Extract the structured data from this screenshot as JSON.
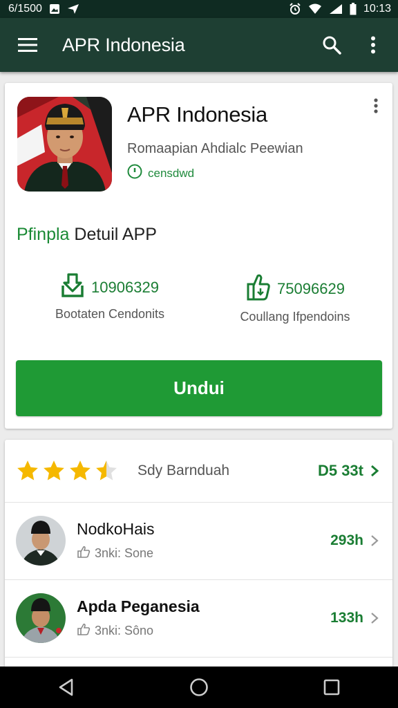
{
  "status_bar": {
    "left_text": "6/1500",
    "time": "10:13",
    "left_icons": [
      "image-icon",
      "location-icon"
    ],
    "right_icons": [
      "alarm-icon",
      "wifi-icon",
      "signal-icon",
      "battery-icon"
    ]
  },
  "app_bar": {
    "title": "APR Indonesia",
    "icons": [
      "menu-icon",
      "search-icon",
      "more-vert-icon"
    ],
    "background": "#1e3f33"
  },
  "app_card": {
    "name": "APR Indonesia",
    "developer": "Romaapian Ahdialc Peewian",
    "badge": "censdwd",
    "section_title_accent": "Pfinpla",
    "section_title_rest": " Detuil APP",
    "stats": [
      {
        "icon": "download-icon",
        "value": "10906329",
        "label": "Bootaten Cendonits"
      },
      {
        "icon": "thumb-download-icon",
        "value": "75096629",
        "label": "Coullang Ifpendoins"
      }
    ],
    "install_label": "Undui",
    "accent_color": "#1f9a35"
  },
  "reviews_card": {
    "rating_stars": 3.5,
    "rating_label": "Sdy Barnduah",
    "rating_count": "D5 33t",
    "reviews": [
      {
        "name": "NodkoHais",
        "meta": "3nki: Sone",
        "count": "293h"
      },
      {
        "name": "Apda Peganesia",
        "meta": "3nki: Sôno",
        "count": "133h"
      }
    ]
  },
  "nav_bar": {
    "buttons": [
      "back-icon",
      "home-icon",
      "recents-icon"
    ]
  }
}
